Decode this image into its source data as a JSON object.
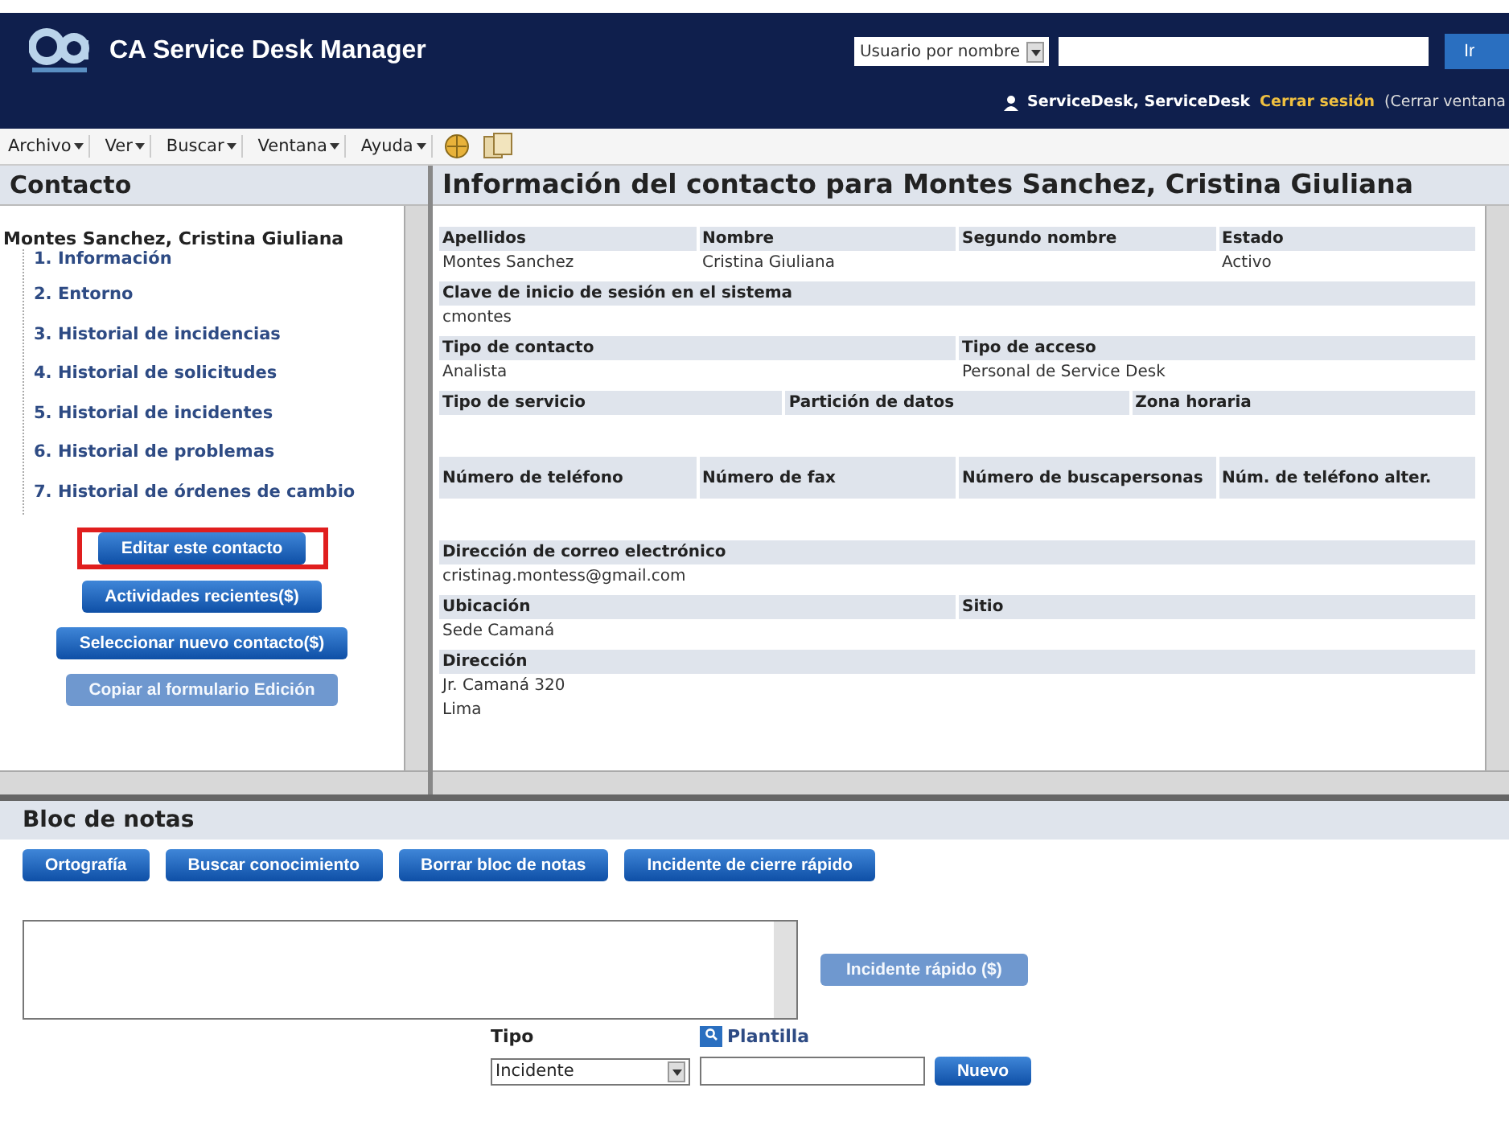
{
  "header": {
    "title": "CA Service Desk Manager",
    "search_select": "Usuario por nombre",
    "go_button": "Ir",
    "user": "ServiceDesk, ServiceDesk",
    "logout": "Cerrar sesión",
    "close_window": "(Cerrar ventana"
  },
  "menu": [
    "Archivo",
    "Ver",
    "Buscar",
    "Ventana",
    "Ayuda"
  ],
  "left_pane": {
    "title": "Contacto",
    "contact_name": "Montes Sanchez, Cristina Giuliana",
    "tree": [
      {
        "label": "1. Información"
      },
      {
        "label": "2. Entorno"
      },
      {
        "label": "3. Historial de incidencias"
      },
      {
        "label": "4. Historial de solicitudes"
      },
      {
        "label": "5. Historial de incidentes"
      },
      {
        "label": "6. Historial de problemas"
      },
      {
        "label": "7. Historial de órdenes de cambio"
      }
    ],
    "buttons": [
      {
        "label": "Editar este contacto",
        "highlighted": true,
        "disabled": false
      },
      {
        "label": "Actividades recientes($)",
        "highlighted": false,
        "disabled": false
      },
      {
        "label": "Seleccionar nuevo contacto($)",
        "highlighted": false,
        "disabled": false
      },
      {
        "label": "Copiar al formulario Edición",
        "highlighted": false,
        "disabled": true
      }
    ]
  },
  "right_pane": {
    "title": "Información del contacto para Montes Sanchez, Cristina Giuliana",
    "sections": [
      {
        "fields": [
          {
            "label": "Apellidos",
            "value": "Montes Sanchez"
          },
          {
            "label": "Nombre",
            "value": "Cristina Giuliana"
          },
          {
            "label": "Segundo nombre"
          },
          {
            "label": "Estado",
            "value": "Activo"
          }
        ]
      },
      {
        "fields": [
          {
            "label": "Clave de inicio de sesión en el sistema",
            "value": "cmontes"
          }
        ]
      },
      {
        "fields": [
          {
            "label": "Tipo de contacto",
            "value": "Analista"
          },
          {
            "label": "Tipo de acceso",
            "value": "Personal de Service Desk"
          }
        ]
      },
      {
        "fields": [
          {
            "label": "Tipo de servicio"
          },
          {
            "label": "Partición de datos"
          },
          {
            "label": "Zona horaria"
          }
        ]
      },
      {
        "fields": [
          {
            "label": "Número de teléfono"
          },
          {
            "label": "Número de fax"
          },
          {
            "label": "Número de buscapersonas"
          },
          {
            "label": "Núm. de teléfono alter."
          }
        ]
      },
      {
        "fields": [
          {
            "label": "Dirección de correo electrónico",
            "value": "cristinag.montess@gmail.com"
          }
        ]
      },
      {
        "fields": [
          {
            "label": "Ubicación",
            "value": "Sede Camaná"
          },
          {
            "label": "Sitio"
          }
        ]
      },
      {
        "fields": [
          {
            "label": "Dirección",
            "value": "Jr. Camaná 320",
            "value2": "Lima"
          }
        ]
      }
    ]
  },
  "notes": {
    "title": "Bloc de notas",
    "buttons": [
      "Ortografía",
      "Buscar conocimiento",
      "Borrar bloc de notas",
      "Incidente de cierre rápido"
    ],
    "quick_button": {
      "label": "Incidente rápido ($)",
      "disabled": true
    },
    "type_label": "Tipo",
    "type_value": "Incidente",
    "template_label": "Plantilla",
    "new_button": "Nuevo"
  }
}
